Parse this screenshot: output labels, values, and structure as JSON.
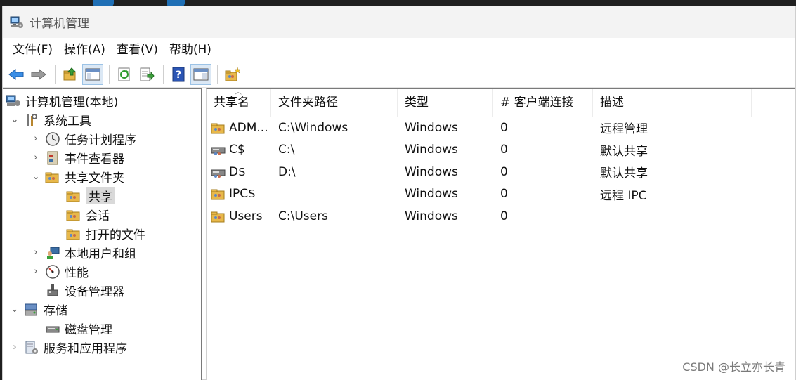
{
  "window": {
    "title": "计算机管理"
  },
  "menu": [
    "文件(F)",
    "操作(A)",
    "查看(V)",
    "帮助(H)"
  ],
  "toolbar": {
    "icons": [
      "back-icon",
      "forward-icon",
      "up-folder-icon",
      "show-hide-tree-icon",
      "refresh-icon",
      "export-list-icon",
      "help-icon",
      "action-pane-icon",
      "new-share-icon"
    ]
  },
  "tree": {
    "root": "计算机管理(本地)",
    "system_tools": "系统工具",
    "task_scheduler": "任务计划程序",
    "event_viewer": "事件查看器",
    "shared_folders": "共享文件夹",
    "shares": "共享",
    "sessions": "会话",
    "open_files": "打开的文件",
    "local_users": "本地用户和组",
    "performance": "性能",
    "device_manager": "设备管理器",
    "storage": "存储",
    "disk_management": "磁盘管理",
    "services_apps": "服务和应用程序"
  },
  "list": {
    "columns": [
      "共享名",
      "文件夹路径",
      "类型",
      "# 客户端连接",
      "描述"
    ],
    "rows": [
      {
        "name": "ADM...",
        "path": "C:\\Windows",
        "type": "Windows",
        "clients": "0",
        "desc": "远程管理"
      },
      {
        "name": "C$",
        "path": "C:\\",
        "type": "Windows",
        "clients": "0",
        "desc": "默认共享"
      },
      {
        "name": "D$",
        "path": "D:\\",
        "type": "Windows",
        "clients": "0",
        "desc": "默认共享"
      },
      {
        "name": "IPC$",
        "path": "",
        "type": "Windows",
        "clients": "0",
        "desc": "远程 IPC"
      },
      {
        "name": "Users",
        "path": "C:\\Users",
        "type": "Windows",
        "clients": "0",
        "desc": ""
      }
    ]
  },
  "watermark": "CSDN @长立亦长青"
}
